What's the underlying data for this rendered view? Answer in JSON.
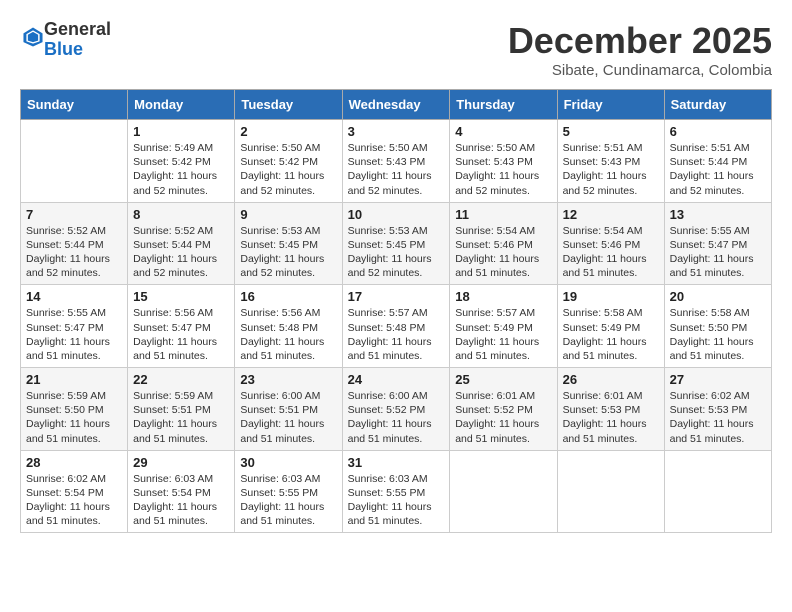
{
  "header": {
    "logo_general": "General",
    "logo_blue": "Blue",
    "month_title": "December 2025",
    "location": "Sibate, Cundinamarca, Colombia"
  },
  "weekdays": [
    "Sunday",
    "Monday",
    "Tuesday",
    "Wednesday",
    "Thursday",
    "Friday",
    "Saturday"
  ],
  "weeks": [
    [
      {
        "day": "",
        "info": ""
      },
      {
        "day": "1",
        "info": "Sunrise: 5:49 AM\nSunset: 5:42 PM\nDaylight: 11 hours\nand 52 minutes."
      },
      {
        "day": "2",
        "info": "Sunrise: 5:50 AM\nSunset: 5:42 PM\nDaylight: 11 hours\nand 52 minutes."
      },
      {
        "day": "3",
        "info": "Sunrise: 5:50 AM\nSunset: 5:43 PM\nDaylight: 11 hours\nand 52 minutes."
      },
      {
        "day": "4",
        "info": "Sunrise: 5:50 AM\nSunset: 5:43 PM\nDaylight: 11 hours\nand 52 minutes."
      },
      {
        "day": "5",
        "info": "Sunrise: 5:51 AM\nSunset: 5:43 PM\nDaylight: 11 hours\nand 52 minutes."
      },
      {
        "day": "6",
        "info": "Sunrise: 5:51 AM\nSunset: 5:44 PM\nDaylight: 11 hours\nand 52 minutes."
      }
    ],
    [
      {
        "day": "7",
        "info": "Sunrise: 5:52 AM\nSunset: 5:44 PM\nDaylight: 11 hours\nand 52 minutes."
      },
      {
        "day": "8",
        "info": "Sunrise: 5:52 AM\nSunset: 5:44 PM\nDaylight: 11 hours\nand 52 minutes."
      },
      {
        "day": "9",
        "info": "Sunrise: 5:53 AM\nSunset: 5:45 PM\nDaylight: 11 hours\nand 52 minutes."
      },
      {
        "day": "10",
        "info": "Sunrise: 5:53 AM\nSunset: 5:45 PM\nDaylight: 11 hours\nand 52 minutes."
      },
      {
        "day": "11",
        "info": "Sunrise: 5:54 AM\nSunset: 5:46 PM\nDaylight: 11 hours\nand 51 minutes."
      },
      {
        "day": "12",
        "info": "Sunrise: 5:54 AM\nSunset: 5:46 PM\nDaylight: 11 hours\nand 51 minutes."
      },
      {
        "day": "13",
        "info": "Sunrise: 5:55 AM\nSunset: 5:47 PM\nDaylight: 11 hours\nand 51 minutes."
      }
    ],
    [
      {
        "day": "14",
        "info": "Sunrise: 5:55 AM\nSunset: 5:47 PM\nDaylight: 11 hours\nand 51 minutes."
      },
      {
        "day": "15",
        "info": "Sunrise: 5:56 AM\nSunset: 5:47 PM\nDaylight: 11 hours\nand 51 minutes."
      },
      {
        "day": "16",
        "info": "Sunrise: 5:56 AM\nSunset: 5:48 PM\nDaylight: 11 hours\nand 51 minutes."
      },
      {
        "day": "17",
        "info": "Sunrise: 5:57 AM\nSunset: 5:48 PM\nDaylight: 11 hours\nand 51 minutes."
      },
      {
        "day": "18",
        "info": "Sunrise: 5:57 AM\nSunset: 5:49 PM\nDaylight: 11 hours\nand 51 minutes."
      },
      {
        "day": "19",
        "info": "Sunrise: 5:58 AM\nSunset: 5:49 PM\nDaylight: 11 hours\nand 51 minutes."
      },
      {
        "day": "20",
        "info": "Sunrise: 5:58 AM\nSunset: 5:50 PM\nDaylight: 11 hours\nand 51 minutes."
      }
    ],
    [
      {
        "day": "21",
        "info": "Sunrise: 5:59 AM\nSunset: 5:50 PM\nDaylight: 11 hours\nand 51 minutes."
      },
      {
        "day": "22",
        "info": "Sunrise: 5:59 AM\nSunset: 5:51 PM\nDaylight: 11 hours\nand 51 minutes."
      },
      {
        "day": "23",
        "info": "Sunrise: 6:00 AM\nSunset: 5:51 PM\nDaylight: 11 hours\nand 51 minutes."
      },
      {
        "day": "24",
        "info": "Sunrise: 6:00 AM\nSunset: 5:52 PM\nDaylight: 11 hours\nand 51 minutes."
      },
      {
        "day": "25",
        "info": "Sunrise: 6:01 AM\nSunset: 5:52 PM\nDaylight: 11 hours\nand 51 minutes."
      },
      {
        "day": "26",
        "info": "Sunrise: 6:01 AM\nSunset: 5:53 PM\nDaylight: 11 hours\nand 51 minutes."
      },
      {
        "day": "27",
        "info": "Sunrise: 6:02 AM\nSunset: 5:53 PM\nDaylight: 11 hours\nand 51 minutes."
      }
    ],
    [
      {
        "day": "28",
        "info": "Sunrise: 6:02 AM\nSunset: 5:54 PM\nDaylight: 11 hours\nand 51 minutes."
      },
      {
        "day": "29",
        "info": "Sunrise: 6:03 AM\nSunset: 5:54 PM\nDaylight: 11 hours\nand 51 minutes."
      },
      {
        "day": "30",
        "info": "Sunrise: 6:03 AM\nSunset: 5:55 PM\nDaylight: 11 hours\nand 51 minutes."
      },
      {
        "day": "31",
        "info": "Sunrise: 6:03 AM\nSunset: 5:55 PM\nDaylight: 11 hours\nand 51 minutes."
      },
      {
        "day": "",
        "info": ""
      },
      {
        "day": "",
        "info": ""
      },
      {
        "day": "",
        "info": ""
      }
    ]
  ]
}
